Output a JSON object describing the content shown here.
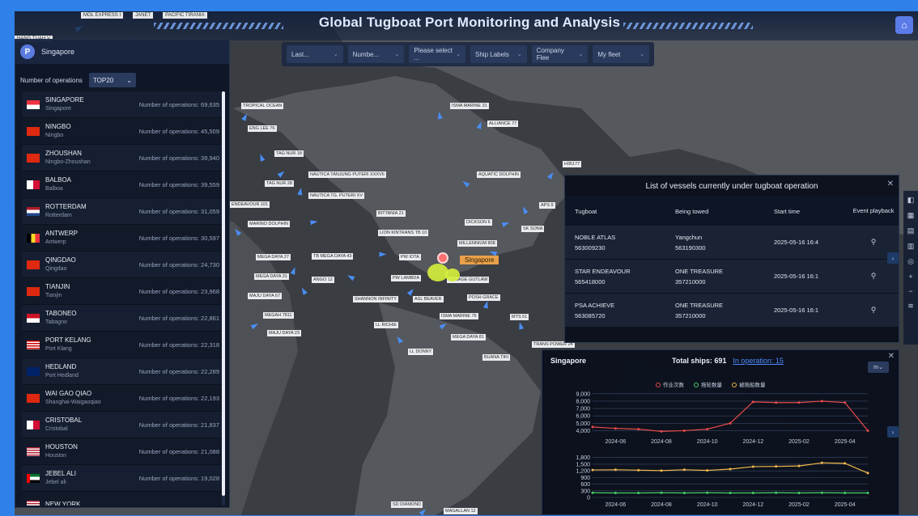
{
  "title": "Global Tugboat Port Monitoring and Analysis",
  "top_tags": [
    "HANG TUAH V",
    "MOL EXPRESS I",
    "JANET",
    "PACIFIC TIRANIA"
  ],
  "filters": [
    {
      "label": "Last..."
    },
    {
      "label": "Numbe..."
    },
    {
      "label": "Please select ..."
    },
    {
      "label": "Ship Labels"
    },
    {
      "label": "Company Flee"
    },
    {
      "label": "My fleet"
    }
  ],
  "left_panel": {
    "logo_letter": "P",
    "location": "Singapore",
    "ops_label": "Number of operations",
    "ops_select": "TOP20",
    "ops_prefix": "Number of operations:",
    "ports": [
      {
        "en": "SINGAPORE",
        "local": "Singapore",
        "ops": "Number of operations: 69,635",
        "flag": "sg"
      },
      {
        "en": "NINGBO",
        "local": "Ningbo",
        "ops": "Number of operations: 45,509",
        "flag": "cn"
      },
      {
        "en": "ZHOUSHAN",
        "local": "Ningbo-Zhoushan",
        "ops": "Number of operations: 39,940",
        "flag": "cn"
      },
      {
        "en": "BALBOA",
        "local": "Balboa",
        "ops": "Number of operations: 39,559",
        "flag": "pa"
      },
      {
        "en": "ROTTERDAM",
        "local": "Rotterdam",
        "ops": "Number of operations: 31,059",
        "flag": "nl"
      },
      {
        "en": "ANTWERP",
        "local": "Antwerp",
        "ops": "Number of operations: 30,597",
        "flag": "be"
      },
      {
        "en": "QINGDAO",
        "local": "Qingdao",
        "ops": "Number of operations: 24,730",
        "flag": "cn"
      },
      {
        "en": "TIANJIN",
        "local": "Tianjin",
        "ops": "Number of operations: 23,968",
        "flag": "cn"
      },
      {
        "en": "TABONEO",
        "local": "Tabagno",
        "ops": "Number of operations: 22,861",
        "flag": "id"
      },
      {
        "en": "PORT KELANG",
        "local": "Port Klang",
        "ops": "Number of operations: 22,318",
        "flag": "my"
      },
      {
        "en": "HEDLAND",
        "local": "Port Hedland",
        "ops": "Number of operations: 22,289",
        "flag": "au"
      },
      {
        "en": "WAI GAO QIAO",
        "local": "Shanghai-Waigaoqiao",
        "ops": "Number of operations: 22,193",
        "flag": "cn"
      },
      {
        "en": "CRISTOBAL",
        "local": "Cristobal",
        "ops": "Number of operations: 21,837",
        "flag": "pa"
      },
      {
        "en": "HOUSTON",
        "local": "Houston",
        "ops": "Number of operations: 21,088",
        "flag": "us"
      },
      {
        "en": "JEBEL ALI",
        "local": "Jebel ali",
        "ops": "Number of operations: 19,028",
        "flag": "ae"
      },
      {
        "en": "NEW YORK",
        "local": "",
        "ops": "",
        "flag": "us"
      }
    ]
  },
  "vessel_panel": {
    "title": "List of vessels currently under tugboat operation",
    "headers": [
      "Tugboat",
      "Being towed",
      "Start time",
      "Event playback"
    ],
    "rows": [
      {
        "tug": "NOBLE ATLAS",
        "tug_id": "563009230",
        "towed": "Yangchun",
        "towed_id": "563190300",
        "time": "2025-05-16 16:4"
      },
      {
        "tug": "STAR ENDEAVOUR",
        "tug_id": "565418000",
        "towed": "ONE TREASURE",
        "towed_id": "357210000",
        "time": "2025-05-16 16:1"
      },
      {
        "tug": "PSA ACHIEVE",
        "tug_id": "563085720",
        "towed": "ONE TREASURE",
        "towed_id": "357210000",
        "time": "2025-05-16 16:1"
      }
    ]
  },
  "stats_panel": {
    "city": "Singapore",
    "total": "Total ships: 691",
    "in_operation": "In operation: 15",
    "select": "m",
    "legend": [
      "作业次数",
      "拖轮数量",
      "被拖船数量"
    ],
    "colors": {
      "ops": "#e84a4a",
      "tugs": "#46d16a",
      "towed": "#f2b94a"
    }
  },
  "map_labels": [
    "TROPICAL OCEAN",
    "ENG LEE 76",
    "TAG NUR 18",
    "NAUTICA TANJUNG PUTERI XXXVII",
    "TAG NUR 28",
    "NAUTICA TG. PUTERI XV",
    "ENDEAVOUR 101",
    "MARINO DOLPHIN",
    "MEGA DAYA 27",
    "TB MEGA DAYA 43",
    "MEGA DAYA 31",
    "ANGO 12",
    "MAJU DAYA 67",
    "MEGAH 7811",
    "MAJU DAYA 23",
    "ISMA MARINE 31",
    "ALLIANCE 77",
    "AQUATIC DOLPHIN",
    "APS 9",
    "BITTANIA 21",
    "DICKSON 6",
    "SK SONA",
    "LION KINTRANS TB 10",
    "MILLENNIUM 808",
    "PW IOTA",
    "PW LAMBDA",
    "ENGAGE GUTLAW",
    "SHANNON INFINITY",
    "ASL BEAVER",
    "POSH GRACE",
    "ISMA MARINE 76",
    "MTS 51",
    "LL RICHIE",
    "MEGA DAYA 81",
    "LL DONNY",
    "TRANS POWER 24",
    "BUANA TIKI",
    "SD DIAMOND",
    "MAGALLAN 12",
    "H35177"
  ],
  "map_marker": "Singapore",
  "icons": [
    "home-icon",
    "close-icon",
    "download-icon",
    "zoom-in-icon",
    "zoom-out-icon",
    "layers-icon"
  ],
  "chart_data": [
    {
      "type": "line",
      "title": "",
      "x": [
        "2024-05",
        "2024-06",
        "2024-07",
        "2024-08",
        "2024-09",
        "2024-10",
        "2024-11",
        "2024-12",
        "2025-01",
        "2025-02",
        "2025-03",
        "2025-04",
        "2025-05"
      ],
      "xticks": [
        "2024-06",
        "2024-08",
        "2024-10",
        "2024-12",
        "2025-02",
        "2025-04"
      ],
      "yticks": [
        4000,
        5000,
        6000,
        7000,
        8000,
        9000
      ],
      "ylim": [
        3500,
        9200
      ],
      "series": [
        {
          "name": "作业次数",
          "values": [
            4500,
            4300,
            4200,
            3900,
            4000,
            4200,
            5000,
            7900,
            7800,
            7800,
            8000,
            7800,
            4000
          ]
        }
      ]
    },
    {
      "type": "line",
      "title": "",
      "x": [
        "2024-05",
        "2024-06",
        "2024-07",
        "2024-08",
        "2024-09",
        "2024-10",
        "2024-11",
        "2024-12",
        "2025-01",
        "2025-02",
        "2025-03",
        "2025-04",
        "2025-05"
      ],
      "xticks": [
        "2024-06",
        "2024-08",
        "2024-10",
        "2024-12",
        "2025-02",
        "2025-04"
      ],
      "yticks": [
        0,
        300,
        600,
        900,
        1200,
        1500,
        1800
      ],
      "ylim": [
        0,
        1900
      ],
      "series": [
        {
          "name": "拖轮数量",
          "values": [
            210,
            200,
            200,
            210,
            200,
            210,
            200,
            200,
            210,
            200,
            210,
            200,
            200
          ]
        },
        {
          "name": "被拖船数量",
          "values": [
            1240,
            1250,
            1230,
            1210,
            1250,
            1220,
            1280,
            1390,
            1400,
            1420,
            1560,
            1540,
            1100
          ]
        }
      ]
    }
  ]
}
